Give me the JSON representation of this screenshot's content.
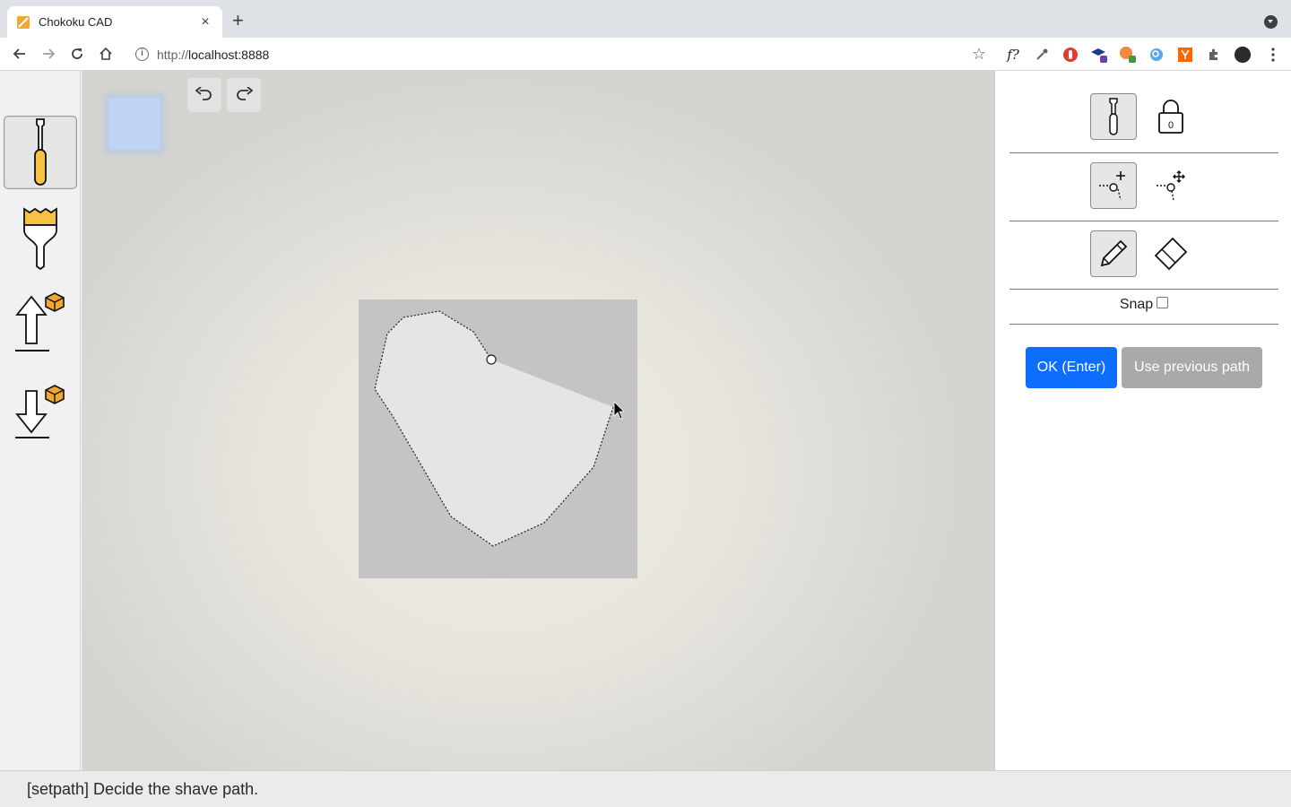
{
  "browser": {
    "tab_title": "Chokoku CAD",
    "url_scheme": "http://",
    "url_host": "localhost:8888",
    "new_tab_label": "+",
    "close_label": "×",
    "star_label": "☆",
    "ext_formula_label": "f?"
  },
  "canvas": {
    "undo_icon": "undo-icon",
    "redo_icon": "redo-icon",
    "stock_color": "#c4c4c4",
    "shave_region_color": "#e5e5e5"
  },
  "left_tools": [
    {
      "name": "chisel-tool",
      "active": true
    },
    {
      "name": "brush-tool",
      "active": false
    },
    {
      "name": "upload-model-tool",
      "active": false
    },
    {
      "name": "download-model-tool",
      "active": false
    }
  ],
  "right_panel": {
    "lock_count": "0",
    "snap_label": "Snap",
    "snap_checked": false,
    "ok_label": "OK (Enter)",
    "prev_path_label": "Use previous path"
  },
  "status": {
    "message": "[setpath] Decide the shave path."
  },
  "colors": {
    "accent": "#0d6efd",
    "tool_yellow": "#f5c242",
    "cube_orange": "#f0a830"
  }
}
